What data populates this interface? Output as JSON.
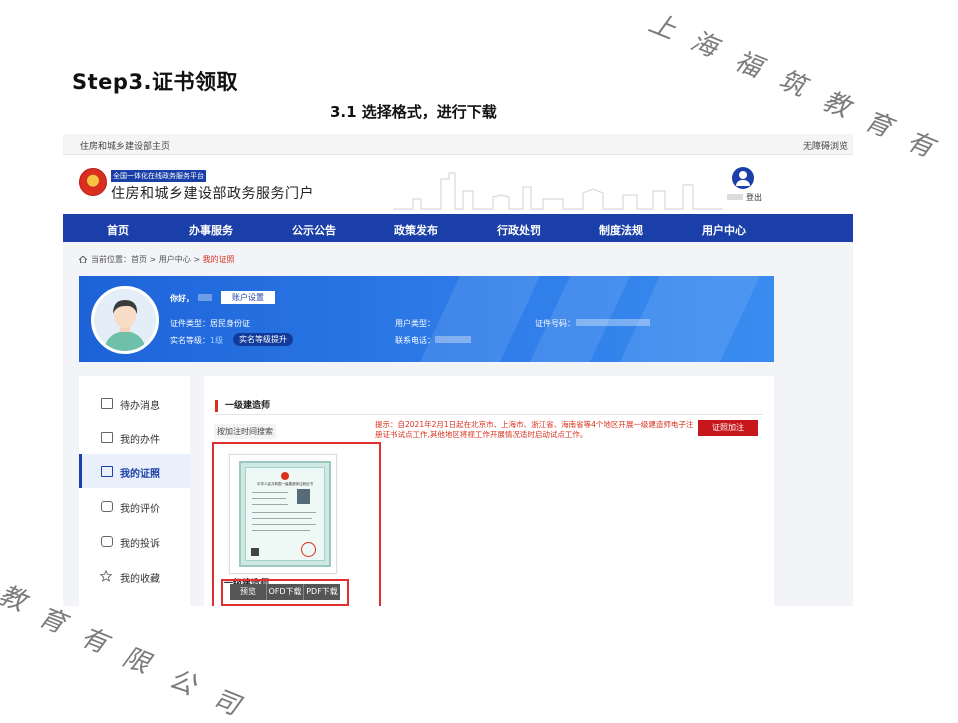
{
  "slide": {
    "title": "Step3.证书领取",
    "subtitle": "3.1 选择格式，进行下载",
    "watermark_top": [
      "上",
      "海",
      "福",
      "筑",
      "教",
      "育",
      "有"
    ],
    "watermark_bottom": [
      "教",
      "育",
      "有",
      "限",
      "公",
      "司"
    ]
  },
  "topbar": {
    "left_link": "住房和城乡建设部主页",
    "right_link": "无障碍浏览"
  },
  "header": {
    "platform_tag": "全国一体化在线政务服务平台",
    "portal_name": "住房和城乡建设部政务服务门户",
    "logout": "登出"
  },
  "nav": {
    "items": [
      "首页",
      "办事服务",
      "公示公告",
      "政策发布",
      "行政处罚",
      "制度法规",
      "用户中心"
    ]
  },
  "breadcrumb": {
    "prefix": "当前位置：首页 > 用户中心 > ",
    "current": "我的证照"
  },
  "profile": {
    "greeting": "你好，",
    "account_settings": "账户设置",
    "id_type_label": "证件类型：",
    "id_type_value": "居民身份证",
    "realname_level_label": "实名等级：",
    "realname_level_value": "1级",
    "upgrade_button": "实名等级提升",
    "user_type_label": "用户类型：",
    "phone_label": "联系电话：",
    "id_number_label": "证件号码："
  },
  "sidebar": {
    "items": [
      {
        "label": "待办消息",
        "icon": "inbox-icon"
      },
      {
        "label": "我的办件",
        "icon": "document-icon"
      },
      {
        "label": "我的证照",
        "icon": "id-card-icon"
      },
      {
        "label": "我的评价",
        "icon": "comment-icon"
      },
      {
        "label": "我的投诉",
        "icon": "complaint-icon"
      },
      {
        "label": "我的收藏",
        "icon": "star-icon"
      }
    ],
    "active_index": 2
  },
  "content": {
    "section_title": "一级建造师",
    "search_label": "按加注时间搜索",
    "notice": "提示：自2021年2月1日起在北京市、上海市、浙江省、海南省等4个地区开展一级建造师电子注册证书试点工作,其他地区将视工作开展情况适时启动试点工作。",
    "add_cert_button": "证照加注",
    "card": {
      "name": "一级建造师",
      "cert_heading": "中华人民共和国一级建造师注册证书",
      "actions": [
        "预览",
        "OFD下载",
        "PDF下载"
      ]
    }
  },
  "colors": {
    "nav_blue": "#1a3fa8",
    "banner_blue": "#2d7be8",
    "alert_red": "#d92f1e",
    "highlight_red": "#e03030"
  }
}
